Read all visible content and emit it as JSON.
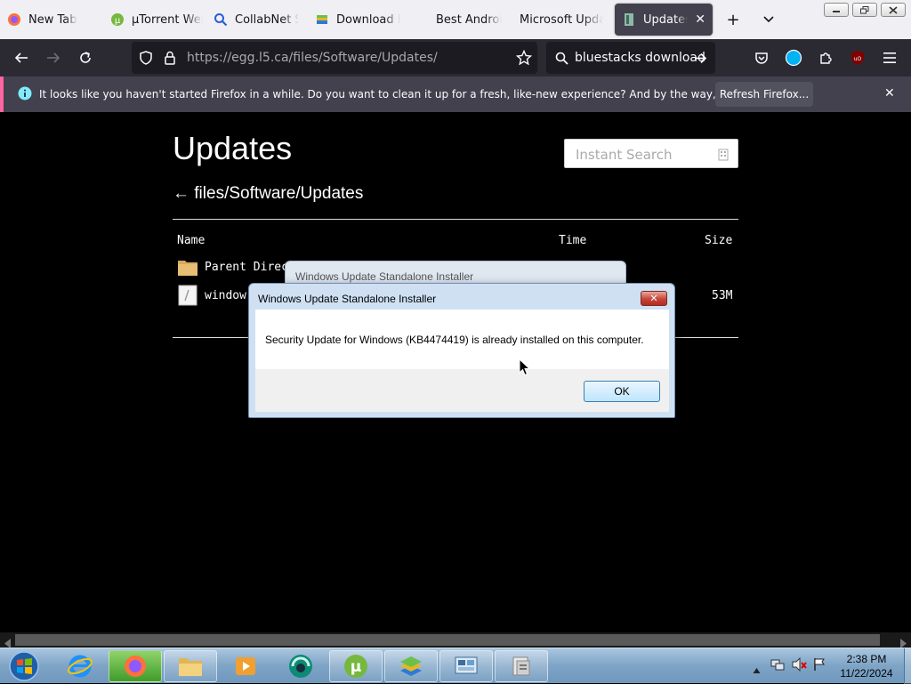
{
  "browser": {
    "tabs": [
      {
        "label": "New Tab",
        "icon": "firefox-icon"
      },
      {
        "label": "µTorrent Web",
        "icon": "utorrent-icon"
      },
      {
        "label": "CollabNet Se",
        "icon": "search-icon"
      },
      {
        "label": "Download Bl",
        "icon": "bluestacks-icon"
      },
      {
        "label": "Best Android",
        "icon": "blank-icon"
      },
      {
        "label": "Microsoft Update",
        "icon": "blank-icon"
      },
      {
        "label": "Updates -",
        "icon": "page-icon",
        "active": true
      }
    ],
    "url": "https://egg.l5.ca/files/Software/Updates/",
    "search_value": "bluestacks download"
  },
  "notification": {
    "message": "It looks like you haven't started Firefox in a while. Do you want to clean it up for a fresh, like-new experience? And by the way, welcome back!",
    "button": "Refresh Firefox..."
  },
  "page": {
    "title": "Updates",
    "search_placeholder": "Instant Search",
    "breadcrumb": "← files/Software/Updates",
    "columns": {
      "name": "Name",
      "time": "Time",
      "size": "Size"
    },
    "rows": [
      {
        "name": "Parent Direc",
        "time": "",
        "size": ""
      },
      {
        "name": "window",
        "time": "",
        "size": "53M"
      }
    ]
  },
  "dialog_back": {
    "title": "Windows Update Standalone Installer"
  },
  "dialog": {
    "title": "Windows Update Standalone Installer",
    "message": "Security Update for Windows (KB4474419) is already installed on this computer.",
    "ok": "OK",
    "close": "✕"
  },
  "taskbar": {
    "time": "2:38 PM",
    "date": "11/22/2024"
  },
  "colors": {
    "tab_active": "#42414d",
    "notif_accent": "#ff65a0",
    "page_bg": "#000000"
  }
}
